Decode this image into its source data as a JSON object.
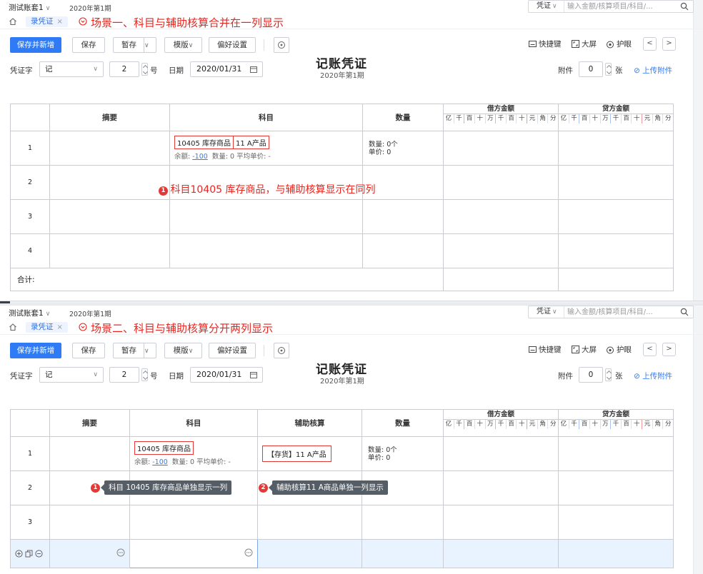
{
  "topbar": {
    "book_name": "测试账套1",
    "period": "2020年第1期",
    "search_type": "凭证",
    "search_placeholder": "输入金额/核算项目/科目/..."
  },
  "tab": {
    "label": "录凭证"
  },
  "toolbar": {
    "save_new": "保存并新增",
    "save": "保存",
    "draft": "暂存",
    "template": "模版",
    "preferences": "偏好设置",
    "shortcut": "快捷键",
    "fullscreen": "大屏",
    "eye_care": "护眼"
  },
  "header": {
    "voucher_word_label": "凭证字",
    "voucher_word": "记",
    "number": "2",
    "number_unit": "号",
    "date_label": "日期",
    "date": "2020/01/31",
    "title": "记账凭证",
    "period": "2020年第1期",
    "attach_label": "附件",
    "attach_count": "0",
    "attach_unit": "张",
    "upload": "上传附件"
  },
  "table": {
    "col_summary": "摘要",
    "col_subject": "科目",
    "col_aux": "辅助核算",
    "col_qty": "数量",
    "debit": "借方金额",
    "credit": "贷方金额",
    "digits": [
      "亿",
      "千",
      "百",
      "十",
      "万",
      "千",
      "百",
      "十",
      "元",
      "角",
      "分"
    ],
    "total_label": "合计:"
  },
  "scene1": {
    "title": "场景一、科目与辅助核算合并在一列显示",
    "subject": "10405 库存商品",
    "aux": "11 A产品",
    "sub_prefix": "余额: ",
    "balance": "-100",
    "sub_suffix": "  数量: 0 平均单价: -",
    "qty_line1": "数量: 0个",
    "qty_line2": "单价: 0",
    "annot_num": "1",
    "annotation": "科目10405 库存商品，与辅助核算显示在同列",
    "rows": [
      "1",
      "2",
      "3",
      "4"
    ]
  },
  "scene2": {
    "title": "场景二、科目与辅助核算分开两列显示",
    "subject": "10405  库存商品",
    "aux": "【存货】11 A产品",
    "sub_prefix": "余额: ",
    "balance": "-100",
    "sub_suffix": "  数量: 0 平均单价: -",
    "qty_line1": "数量: 0个",
    "qty_line2": "单价: 0",
    "tip1_num": "1",
    "tip1": "科目 10405 库存商品单独显示一列",
    "tip2_num": "2",
    "tip2": "辅助核算11 A商品单独一列显示",
    "rows": [
      "1",
      "2",
      "3"
    ]
  },
  "colors": {
    "primary": "#2f7bf5",
    "annotation": "#e8251f",
    "border": "#c9ccd1"
  }
}
